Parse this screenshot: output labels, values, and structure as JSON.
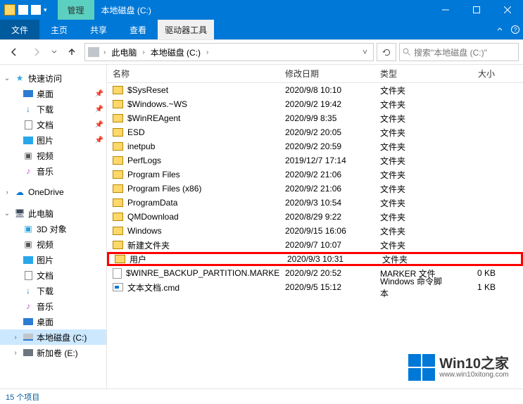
{
  "title_tab": "管理",
  "window_title": "本地磁盘 (C:)",
  "ribbon": {
    "file": "文件",
    "home": "主页",
    "share": "共享",
    "view": "查看",
    "context": "驱动器工具"
  },
  "breadcrumbs": {
    "root": "此电脑",
    "current": "本地磁盘 (C:)"
  },
  "search_placeholder": "搜索\"本地磁盘 (C:)\"",
  "sidebar": {
    "quick_access": "快速访问",
    "desktop": "桌面",
    "downloads": "下载",
    "documents": "文档",
    "pictures": "图片",
    "videos": "视频",
    "music": "音乐",
    "onedrive": "OneDrive",
    "this_pc": "此电脑",
    "objects_3d": "3D 对象",
    "videos2": "视频",
    "pictures2": "图片",
    "documents2": "文档",
    "downloads2": "下载",
    "music2": "音乐",
    "desktop2": "桌面",
    "drive_c": "本地磁盘 (C:)",
    "drive_e": "新加卷 (E:)"
  },
  "columns": {
    "name": "名称",
    "date": "修改日期",
    "type": "类型",
    "size": "大小"
  },
  "rows": [
    {
      "name": "$SysReset",
      "date": "2020/9/8 10:10",
      "type": "文件夹",
      "size": "",
      "icon": "folder",
      "hl": false
    },
    {
      "name": "$Windows.~WS",
      "date": "2020/9/2 19:42",
      "type": "文件夹",
      "size": "",
      "icon": "folder",
      "hl": false
    },
    {
      "name": "$WinREAgent",
      "date": "2020/9/9 8:35",
      "type": "文件夹",
      "size": "",
      "icon": "folder",
      "hl": false
    },
    {
      "name": "ESD",
      "date": "2020/9/2 20:05",
      "type": "文件夹",
      "size": "",
      "icon": "folder",
      "hl": false
    },
    {
      "name": "inetpub",
      "date": "2020/9/2 20:59",
      "type": "文件夹",
      "size": "",
      "icon": "folder",
      "hl": false
    },
    {
      "name": "PerfLogs",
      "date": "2019/12/7 17:14",
      "type": "文件夹",
      "size": "",
      "icon": "folder",
      "hl": false
    },
    {
      "name": "Program Files",
      "date": "2020/9/2 21:06",
      "type": "文件夹",
      "size": "",
      "icon": "folder",
      "hl": false
    },
    {
      "name": "Program Files (x86)",
      "date": "2020/9/2 21:06",
      "type": "文件夹",
      "size": "",
      "icon": "folder",
      "hl": false
    },
    {
      "name": "ProgramData",
      "date": "2020/9/3 10:54",
      "type": "文件夹",
      "size": "",
      "icon": "folder",
      "hl": false
    },
    {
      "name": "QMDownload",
      "date": "2020/8/29 9:22",
      "type": "文件夹",
      "size": "",
      "icon": "folder",
      "hl": false
    },
    {
      "name": "Windows",
      "date": "2020/9/15 16:06",
      "type": "文件夹",
      "size": "",
      "icon": "folder",
      "hl": false
    },
    {
      "name": "新建文件夹",
      "date": "2020/9/7 10:07",
      "type": "文件夹",
      "size": "",
      "icon": "folder",
      "hl": false
    },
    {
      "name": "用户",
      "date": "2020/9/3 10:31",
      "type": "文件夹",
      "size": "",
      "icon": "folder",
      "hl": true
    },
    {
      "name": "$WINRE_BACKUP_PARTITION.MARKER",
      "date": "2020/9/2 20:52",
      "type": "MARKER 文件",
      "size": "0 KB",
      "icon": "file",
      "hl": false
    },
    {
      "name": "文本文档.cmd",
      "date": "2020/9/5 15:12",
      "type": "Windows 命令脚本",
      "size": "1 KB",
      "icon": "cmd",
      "hl": false
    }
  ],
  "status": "15 个项目",
  "watermark": {
    "name": "Win10之家",
    "url": "www.win10xitong.com"
  }
}
